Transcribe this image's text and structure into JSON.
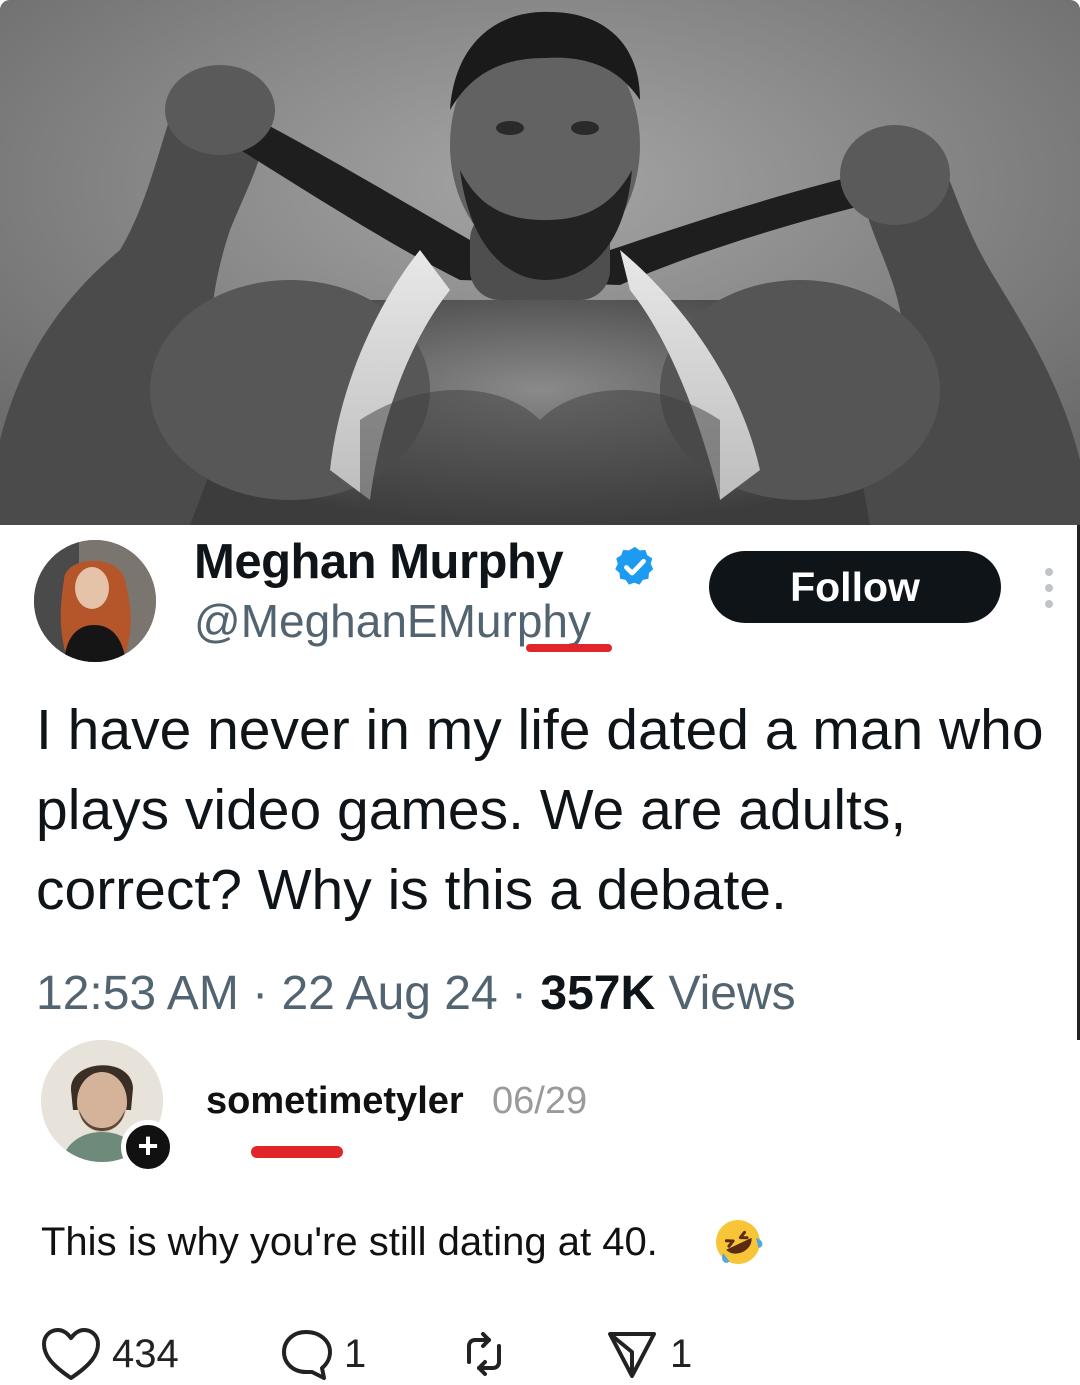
{
  "photo": {
    "icon": "shirtless-bodybuilder-photo"
  },
  "tweet": {
    "author": {
      "display_name": "Meghan Murphy",
      "handle": "@MeghanEMurphy",
      "verified": true
    },
    "follow_label": "Follow",
    "text": "I have never in my life dated a man who plays video games. We are adults, correct? Why is this a debate.",
    "meta": {
      "time": "12:53 AM",
      "separator": "·",
      "date": "22 Aug 24",
      "views_count": "357K",
      "views_label": "Views"
    }
  },
  "comment": {
    "username": "sometimetyler",
    "date": "06/29",
    "text": "This is why you're still dating at 40.",
    "emoji": "rolling-on-floor-laughing"
  },
  "actions": {
    "likes": "434",
    "replies": "1",
    "shares": "1"
  },
  "colors": {
    "verified_blue": "#1d9bf0",
    "follow_bg": "#0f1419",
    "muted_text": "#536471",
    "redaction_red": "#e0252b"
  }
}
